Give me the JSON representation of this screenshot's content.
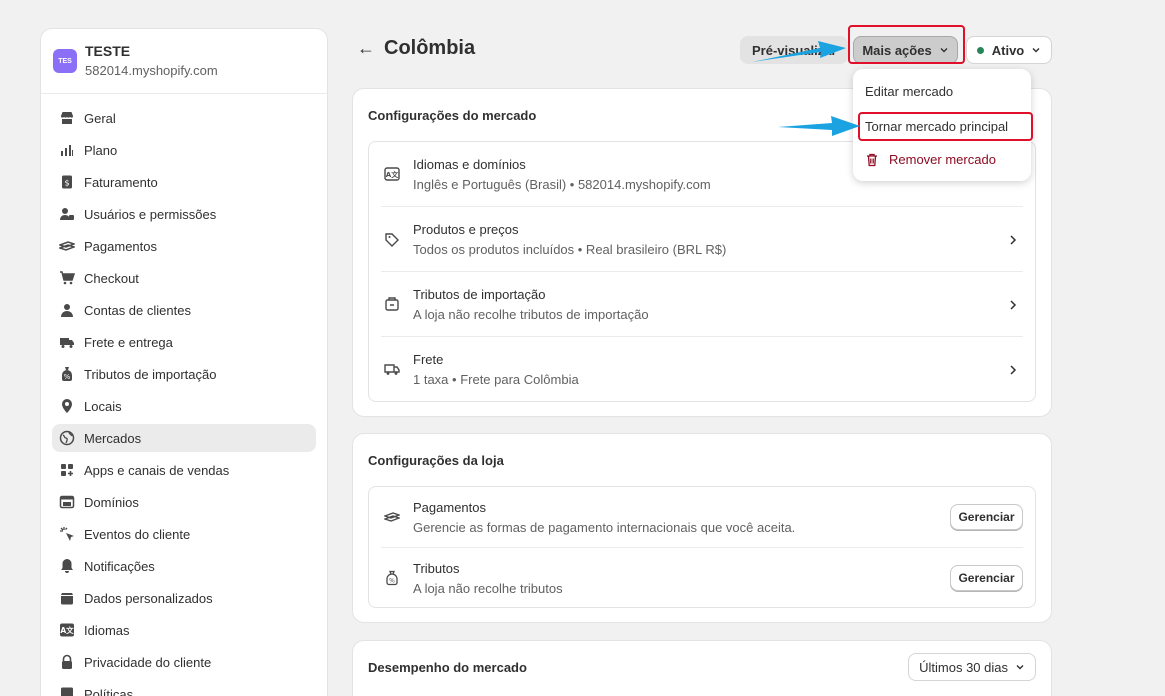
{
  "store": {
    "avatar": "TES",
    "name": "TESTE",
    "domain": "582014.myshopify.com"
  },
  "sidebar": {
    "items": [
      {
        "label": "Geral",
        "icon": "store-icon"
      },
      {
        "label": "Plano",
        "icon": "plan-icon"
      },
      {
        "label": "Faturamento",
        "icon": "billing-icon"
      },
      {
        "label": "Usuários e permissões",
        "icon": "users-icon"
      },
      {
        "label": "Pagamentos",
        "icon": "payments-icon"
      },
      {
        "label": "Checkout",
        "icon": "cart-icon"
      },
      {
        "label": "Contas de clientes",
        "icon": "person-icon"
      },
      {
        "label": "Frete e entrega",
        "icon": "truck-icon"
      },
      {
        "label": "Tributos de importação",
        "icon": "duties-icon"
      },
      {
        "label": "Locais",
        "icon": "location-icon"
      },
      {
        "label": "Mercados",
        "icon": "globe-icon"
      },
      {
        "label": "Apps e canais de vendas",
        "icon": "apps-icon"
      },
      {
        "label": "Domínios",
        "icon": "domains-icon"
      },
      {
        "label": "Eventos do cliente",
        "icon": "cursor-icon"
      },
      {
        "label": "Notificações",
        "icon": "bell-icon"
      },
      {
        "label": "Dados personalizados",
        "icon": "data-icon"
      },
      {
        "label": "Idiomas",
        "icon": "language-icon"
      },
      {
        "label": "Privacidade do cliente",
        "icon": "lock-icon"
      },
      {
        "label": "Políticas",
        "icon": "policy-icon"
      }
    ],
    "active": "Mercados"
  },
  "header": {
    "back": "←",
    "title": "Colômbia",
    "preview_label": "Pré-visualizar",
    "more_label": "Mais ações",
    "status_label": "Ativo"
  },
  "dropdown": {
    "edit": "Editar mercado",
    "make_primary": "Tornar mercado principal",
    "remove": "Remover mercado"
  },
  "market_settings": {
    "title": "Configurações do mercado",
    "rows": [
      {
        "title": "Idiomas e domínios",
        "sub": "Inglês e Português (Brasil) • 582014.myshopify.com"
      },
      {
        "title": "Produtos e preços",
        "sub": "Todos os produtos incluídos • Real brasileiro (BRL R$)"
      },
      {
        "title": "Tributos de importação",
        "sub": "A loja não recolhe tributos de importação"
      },
      {
        "title": "Frete",
        "sub": "1 taxa • Frete para Colômbia"
      }
    ]
  },
  "store_settings": {
    "title": "Configurações da loja",
    "rows": [
      {
        "title": "Pagamentos",
        "sub": "Gerencie as formas de pagamento internacionais que você aceita.",
        "button": "Gerenciar"
      },
      {
        "title": "Tributos",
        "sub": "A loja não recolhe tributos",
        "button": "Gerenciar"
      }
    ]
  },
  "performance": {
    "title": "Desempenho do mercado",
    "period": "Últimos 30 dias"
  },
  "colors": {
    "highlight": "#e0102b",
    "arrow": "#1aa3e0",
    "active_dot": "#29845a",
    "danger": "#8e0b21"
  }
}
